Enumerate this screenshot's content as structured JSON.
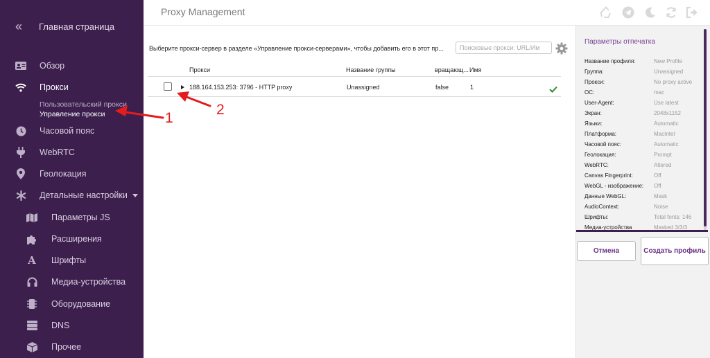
{
  "sidebar": {
    "home_label": "Главная страница",
    "items": [
      {
        "label": "Обзор",
        "icon": "id-card-icon"
      },
      {
        "label": "Прокси",
        "icon": "wifi-icon"
      },
      {
        "label": "Часовой пояс",
        "icon": "clock-icon"
      },
      {
        "label": "WebRTC",
        "icon": "plug-icon"
      },
      {
        "label": "Геолокация",
        "icon": "location-pin-icon"
      },
      {
        "label": "Детальные настройки",
        "icon": "asterisk-icon"
      },
      {
        "label": "Параметры JS",
        "icon": "map-icon"
      },
      {
        "label": "Расширения",
        "icon": "puzzle-icon"
      },
      {
        "label": "Шрифты",
        "icon": "font-icon"
      },
      {
        "label": "Медиа-устройства",
        "icon": "headphones-icon"
      },
      {
        "label": "Оборудование",
        "icon": "chip-icon"
      },
      {
        "label": "DNS",
        "icon": "server-icon"
      },
      {
        "label": "Прочее",
        "icon": "cube-icon"
      }
    ],
    "proxy_sub": [
      "Пользовательский прокси",
      "Управление прокси"
    ]
  },
  "header": {
    "title": "Proxy Management",
    "icons": [
      "recycle-icon",
      "telegram-icon",
      "moon-icon",
      "refresh-icon",
      "logout-icon"
    ]
  },
  "main": {
    "hint": "Выберите прокси-сервер в разделе «Управление прокси-серверами», чтобы добавить его в этот пр...",
    "search_placeholder": "Поисковые прокси: URL/Им",
    "columns": [
      "Прокси",
      "Название группы",
      "вращающ...",
      "Имя"
    ],
    "rows": [
      {
        "proxy": "188.164.153.253: 3796 - HTTP proxy",
        "group": "Unassigned",
        "rotating": "false",
        "name": "1"
      }
    ]
  },
  "annotations": [
    "1",
    "2"
  ],
  "right_panel": {
    "title": "Параметры отпечатка",
    "rows": [
      {
        "key": "Название профиля:",
        "value": "New Profile"
      },
      {
        "key": "Группа:",
        "value": "Unassigned"
      },
      {
        "key": "Прокси:",
        "value": "No proxy active"
      },
      {
        "key": "ОС:",
        "value": "mac"
      },
      {
        "key": "User-Agent:",
        "value": "Use latest"
      },
      {
        "key": "Экран:",
        "value": "2048x1152"
      },
      {
        "key": "Языки:",
        "value": "Automatic"
      },
      {
        "key": "Платформа:",
        "value": "MacIntel"
      },
      {
        "key": "Часовой пояс:",
        "value": "Automatic"
      },
      {
        "key": "Геолокация:",
        "value": "Prompt"
      },
      {
        "key": "WebRTC:",
        "value": "Altered"
      },
      {
        "key": "Canvas Fingerprint:",
        "value": "Off"
      },
      {
        "key": "WebGL - изображение:",
        "value": "Off"
      },
      {
        "key": "Данные WebGL:",
        "value": "Mask"
      },
      {
        "key": "AudioContext:",
        "value": "Noise"
      },
      {
        "key": "Шрифты:",
        "value": "Total fonts: 146"
      },
      {
        "key": "Медиа-устройства",
        "value": "Masked 3/3/3"
      }
    ],
    "cancel_label": "Отмена",
    "create_label": "Создать профиль"
  },
  "colors": {
    "sidebar_bg": "#3d1f4e",
    "accent": "#6b2f86",
    "annotation": "#e41c1c",
    "check": "#2e8b2e"
  }
}
